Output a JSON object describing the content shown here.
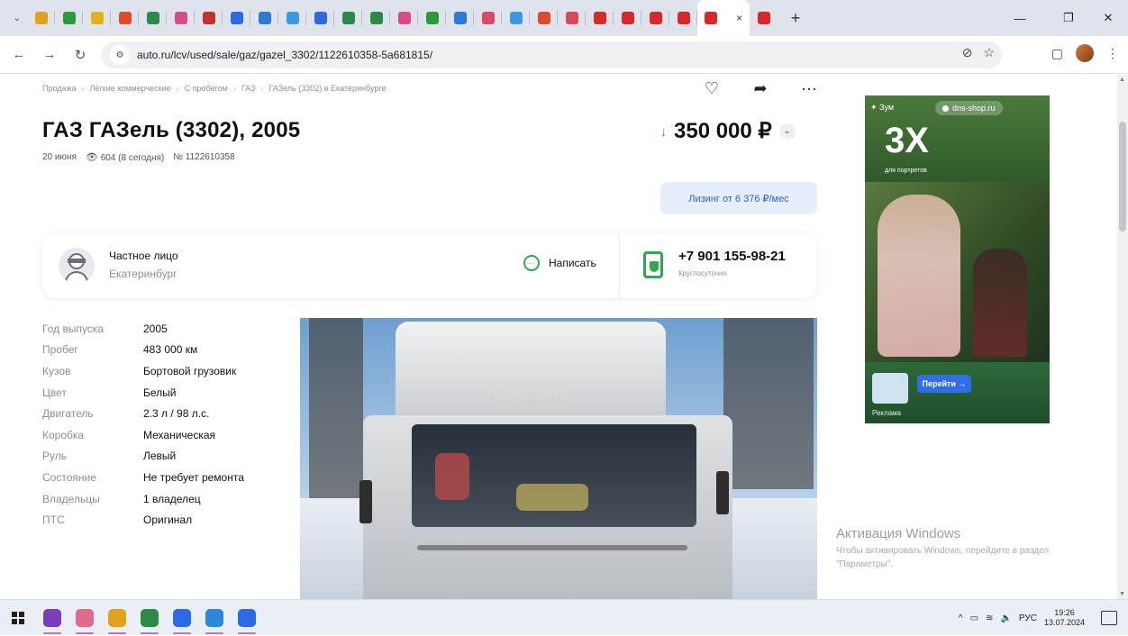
{
  "browser": {
    "tab_favicon_colors": [
      "#e0a21b",
      "#2b9a3a",
      "#e0b21b",
      "#e04a2b",
      "#2b8a4a",
      "#d84a8a",
      "#c2342a",
      "#2b6ae0",
      "#2b7ad8",
      "#3b9ae0",
      "#2b6ae0",
      "#2b8a4a",
      "#2b8a4a",
      "#d84a8a",
      "#2b9a3a",
      "#2b7ad8",
      "#d84a6a",
      "#3b9ae0",
      "#e04a2b",
      "#d84a5a",
      "#d8282a",
      "#d8282a",
      "#d8282a",
      "#d8282a"
    ],
    "active_tab_favicon_color": "#d8282a",
    "new_tab_icon": "plus-icon",
    "window_controls": [
      "minimize-icon",
      "restore-icon",
      "close-icon"
    ],
    "url": "auto.ru/lcv/used/sale/gaz/gazel_3302/1122610358-5a681815/"
  },
  "page": {
    "breadcrumb": [
      "Продажа",
      "Лёгкие коммерческие",
      "С пробегом",
      "ГАЗ",
      "ГАЗель (3302) в Екатеринбурге"
    ],
    "title": "ГАЗ ГАЗель (3302), 2005",
    "date": "20 июня",
    "views": "604 (8 сегодня)",
    "listing_number": "№ 1122610358",
    "price": "350 000 ₽",
    "price_trend_icon": "arrow-down-icon",
    "leasing": "Лизинг от 6 376 ₽/мес",
    "seller": {
      "type": "Частное лицо",
      "city": "Екатеринбург",
      "write_label": "Написать",
      "phone": "+7 901 155-98-21",
      "phone_note": "Круглосуточно"
    },
    "specs": [
      {
        "label": "Год выпуска",
        "value": "2005"
      },
      {
        "label": "Пробег",
        "value": "483 000 км"
      },
      {
        "label": "Кузов",
        "value": "Бортовой грузовик"
      },
      {
        "label": "Цвет",
        "value": "Белый"
      },
      {
        "label": "Двигатель",
        "value": "2.3 л / 98 л.с."
      },
      {
        "label": "Коробка",
        "value": "Механическая"
      },
      {
        "label": "Руль",
        "value": "Левый"
      },
      {
        "label": "Состояние",
        "value": "Не требует ремонта"
      },
      {
        "label": "Владельцы",
        "value": "1 владелец"
      },
      {
        "label": "ПТС",
        "value": "Оригинал"
      }
    ],
    "photo_text": "GAZelle"
  },
  "ad": {
    "brand": "Зум",
    "shop": "dns-shop.ru",
    "headline": "3X",
    "subline": "для портретов",
    "button": "Перейти →",
    "label": "Реклама"
  },
  "watermark": {
    "title": "Активация Windows",
    "subtitle": "Чтобы активировать Windows, перейдите в раздел \"Параметры\"."
  },
  "taskbar": {
    "app_colors": [
      "#7a3eb8",
      "#e06a8a",
      "#e0a21b",
      "#2b8a4a",
      "#2b6ae0",
      "#2b8ad8",
      "#2b6ae0"
    ],
    "lang": "РУС",
    "time": "19:26",
    "date": "13.07.2024"
  }
}
